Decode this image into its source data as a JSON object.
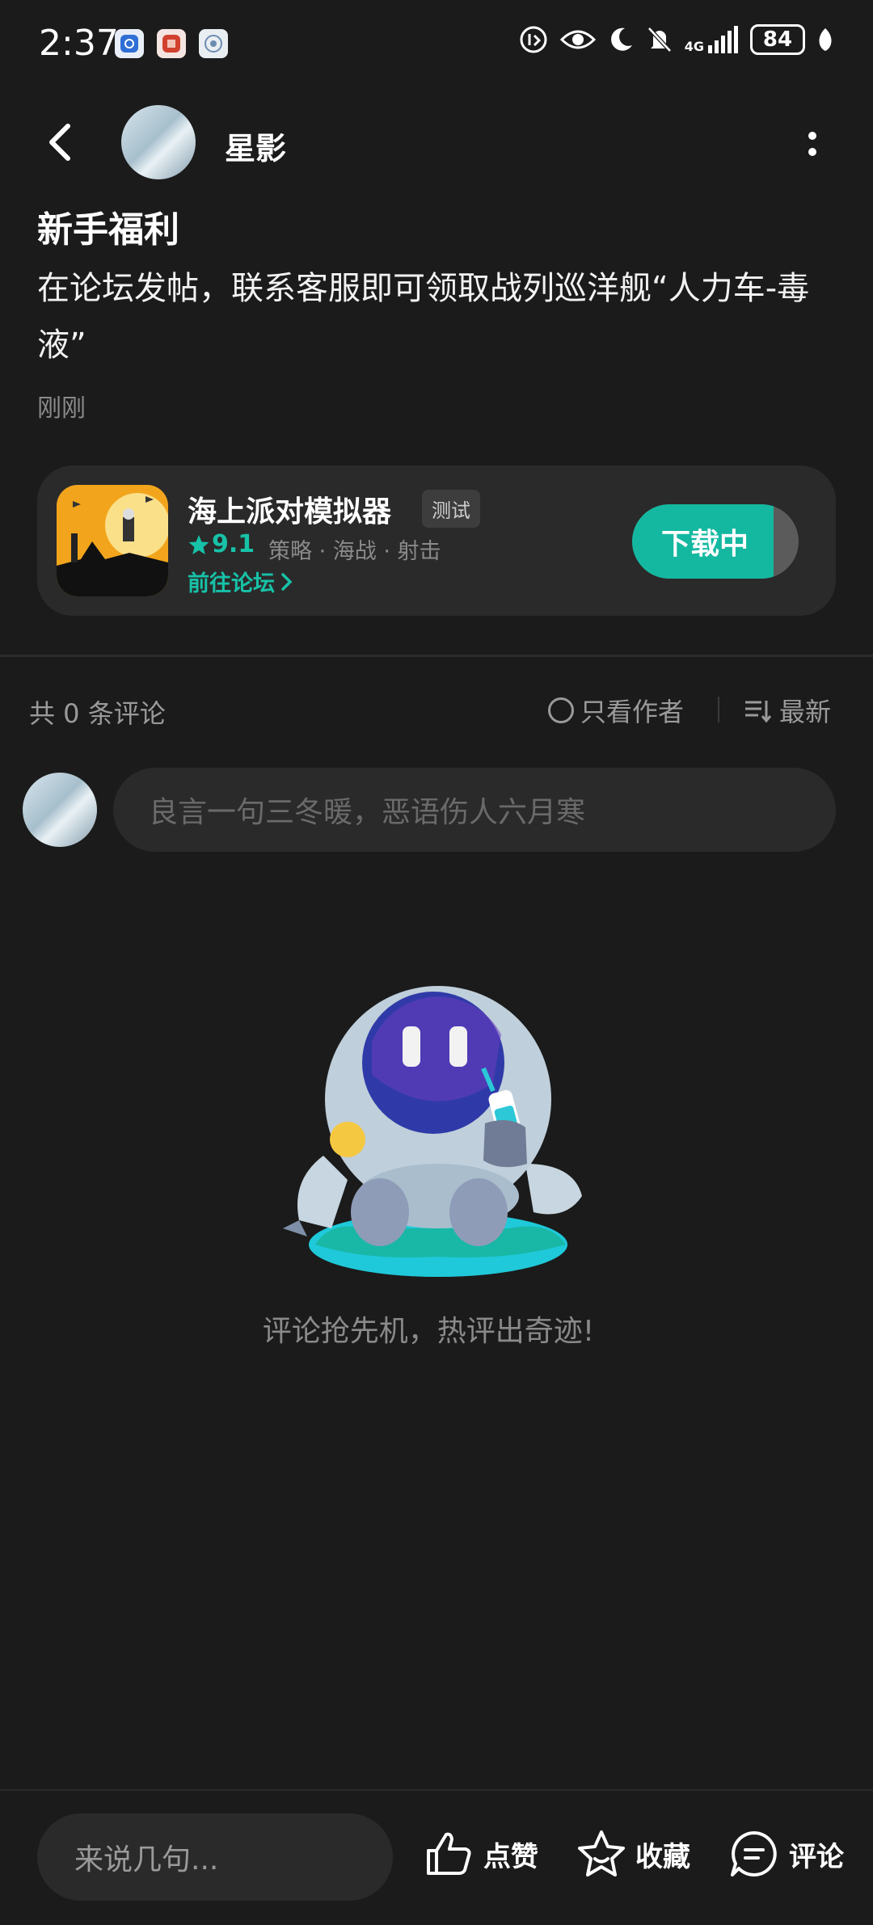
{
  "status_bar": {
    "time": "2:37",
    "network": "4G",
    "battery": "84"
  },
  "header": {
    "username": "星影"
  },
  "post": {
    "title": "新手福利",
    "body": "在论坛发帖，联系客服即可领取战列巡洋舰“人力车-毒液”",
    "time": "刚刚"
  },
  "game_card": {
    "name": "海上派对模拟器",
    "tag": "测试",
    "rating": "9.1",
    "genres": "策略 · 海战 · 射击",
    "forum_link": "前往论坛",
    "download_label": "下载中",
    "download_progress": 0.85
  },
  "comments": {
    "count_label": "共 0 条评论",
    "author_only_label": "只看作者",
    "sort_label": "最新",
    "input_placeholder": "良言一句三冬暖，恶语伤人六月寒",
    "empty_text": "评论抢先机，热评出奇迹!"
  },
  "bottom_bar": {
    "input_placeholder": "来说几句...",
    "like_label": "点赞",
    "favorite_label": "收藏",
    "comment_label": "评论"
  },
  "colors": {
    "accent": "#14b8a0",
    "background": "#1b1b1b",
    "card": "#2a2a2a"
  },
  "icons": [
    "back-icon",
    "more-icon",
    "star-icon",
    "chevron-right-icon",
    "circle-icon",
    "sort-icon",
    "like-icon",
    "favorite-icon",
    "comment-icon"
  ]
}
